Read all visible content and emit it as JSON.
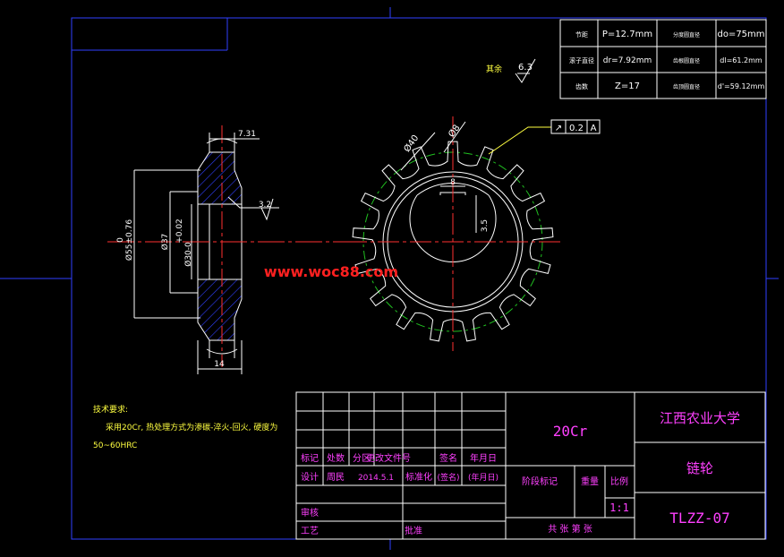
{
  "params": {
    "pitch_label": "节距",
    "pitch_value": "P=12.7mm",
    "roller_label": "滚子直径",
    "roller_value": "dr=7.92mm",
    "teeth_label": "齿数",
    "teeth_value": "Z=17",
    "pitch_dia_label": "分度圆直径",
    "pitch_dia_value": "do=75mm",
    "root_dia_label": "齿根圆直径",
    "root_dia_value": "dl=61.2mm",
    "tip_dia_label": "齿顶圆直径",
    "tip_dia_value": "d'=59.12mm"
  },
  "roughness": {
    "label": "其余",
    "value": "6.3"
  },
  "section_dims": {
    "width_top": "7.31",
    "bore_tol": "+0.02",
    "bore_dia": "Ø37",
    "bore_dia2": "Ø30-0",
    "outer_dia": "Ø55±0.76",
    "outer_prefix": "0",
    "roughness_value": "3.2",
    "hub_width": "14"
  },
  "front_dims": {
    "dia_a": "Ø40",
    "dia_b": "Ø8",
    "key_width": "8",
    "key_depth": "3.5",
    "tolerance_symbol": "↗",
    "tolerance_value": "0.2",
    "tolerance_datum": "A"
  },
  "watermark": "www.woc88.com",
  "tech_requirements": {
    "title": "技术要求:",
    "line1": "采用20Cr, 热处理方式为渗碳-淬火-回火, 硬度为",
    "line2": "50~60HRC"
  },
  "title_block": {
    "material": "20Cr",
    "school": "江西农业大学",
    "part_name": "链轮",
    "drawing_no": "TLZZ-07",
    "h_mark": "标记",
    "h_count": "处数",
    "h_zone": "分区",
    "h_doc": "更改文件号",
    "h_sign": "签名",
    "h_date": "年月日",
    "design_label": "设计",
    "designer": "周民",
    "design_date": "2014.5.1",
    "standard_label": "标准化",
    "sign2": "(签名)",
    "date2": "(年月日)",
    "stage_label": "阶段标记",
    "weight_label": "重量",
    "scale_label": "比例",
    "scale_value": "1:1",
    "review_label": "审核",
    "process_label": "工艺",
    "approve_label": "批准",
    "sheets": "共  张 第  张"
  }
}
